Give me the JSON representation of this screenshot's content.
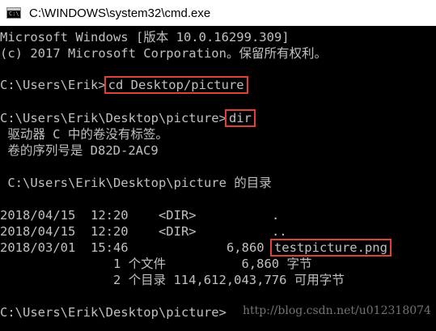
{
  "window": {
    "title": "C:\\WINDOWS\\system32\\cmd.exe",
    "icon": "cmd-icon"
  },
  "console": {
    "banner": [
      "Microsoft Windows [版本 10.0.16299.309]",
      "(c) 2017 Microsoft Corporation。保留所有权利。"
    ],
    "cmd1_prompt": "C:\\Users\\Erik>",
    "cmd1_command": "cd Desktop/picture",
    "cmd2_prompt": "C:\\Users\\Erik\\Desktop\\picture>",
    "cmd2_command": "dir",
    "volume_line1": " 驱动器 C 中的卷没有标签。",
    "volume_line2": " 卷的序列号是 D82D-2AC9",
    "dir_header": " C:\\Users\\Erik\\Desktop\\picture 的目录",
    "entries": [
      {
        "line": "2018/04/15  12:20    <DIR>          ."
      },
      {
        "line": "2018/04/15  12:20    <DIR>          .."
      },
      {
        "line_prefix": "2018/03/01  15:46             6,860 ",
        "filename": "testpicture.png"
      }
    ],
    "summary_files": "               1 个文件          6,860 字节",
    "summary_dirs": "               2 个目录 114,612,043,776 可用字节",
    "final_prompt": "C:\\Users\\Erik\\Desktop\\picture>",
    "watermark": "http://blog.csdn.net/u012318074",
    "highlight_color": "#e0403a"
  }
}
